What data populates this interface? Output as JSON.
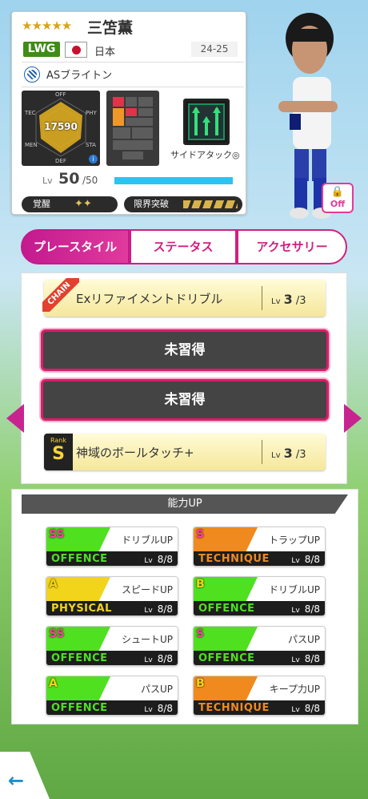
{
  "player": {
    "stars": "★★★★★",
    "name": "三笘薫",
    "position": "LWG",
    "country": "日本",
    "season": "24-25",
    "club": "ASブライトン",
    "overall": "17590",
    "radar_labels": {
      "off": "OFF",
      "tec": "TEC",
      "phy": "PHY",
      "men": "MEN",
      "sta": "STA",
      "def": "DEF"
    },
    "playstyle": "サイドアタック◎",
    "level_prefix": "Lv",
    "level": "50",
    "level_max": "/50",
    "level_progress": 1.0,
    "awakening_label": "覚醒",
    "awakening_gems": "✦✦",
    "limit_break_label": "限界突破",
    "lock_label": "Off"
  },
  "tabs": [
    {
      "label": "プレースタイル",
      "active": true
    },
    {
      "label": "ステータス",
      "active": false
    },
    {
      "label": "アクセサリー",
      "active": false
    }
  ],
  "skills": [
    {
      "badge": "CHAIN",
      "name": "Exリファイメントドリブル",
      "lv_prefix": "Lv",
      "lv": "3",
      "lv_max": "/3"
    },
    {
      "empty_label": "未習得"
    },
    {
      "empty_label": "未習得"
    },
    {
      "badge_small": "Rank",
      "badge": "S",
      "name": "神域のボールタッチ+",
      "lv_prefix": "Lv",
      "lv": "3",
      "lv_max": "/3"
    }
  ],
  "abilities_title": "能力UP",
  "abilities": [
    {
      "rank": "SS",
      "name": "ドリブルUP",
      "category": "OFFENCE",
      "lv_prefix": "Lv",
      "lv": "8/8"
    },
    {
      "rank": "S",
      "name": "トラップUP",
      "category": "TECHNIQUE",
      "lv_prefix": "Lv",
      "lv": "8/8"
    },
    {
      "rank": "A",
      "name": "スピードUP",
      "category": "PHYSICAL",
      "lv_prefix": "Lv",
      "lv": "8/8"
    },
    {
      "rank": "B",
      "name": "ドリブルUP",
      "category": "OFFENCE",
      "lv_prefix": "Lv",
      "lv": "8/8"
    },
    {
      "rank": "SS",
      "name": "シュートUP",
      "category": "OFFENCE",
      "lv_prefix": "Lv",
      "lv": "8/8"
    },
    {
      "rank": "S",
      "name": "パスUP",
      "category": "OFFENCE",
      "lv_prefix": "Lv",
      "lv": "8/8"
    },
    {
      "rank": "A",
      "name": "パスUP",
      "category": "OFFENCE",
      "lv_prefix": "Lv",
      "lv": "8/8"
    },
    {
      "rank": "B",
      "name": "キープ力UP",
      "category": "TECHNIQUE",
      "lv_prefix": "Lv",
      "lv": "8/8"
    }
  ],
  "colors": {
    "offence": "#4fe020",
    "technique": "#f08a1e",
    "physical": "#f2d41a",
    "accent": "#d0207e"
  },
  "back_icon": "←"
}
